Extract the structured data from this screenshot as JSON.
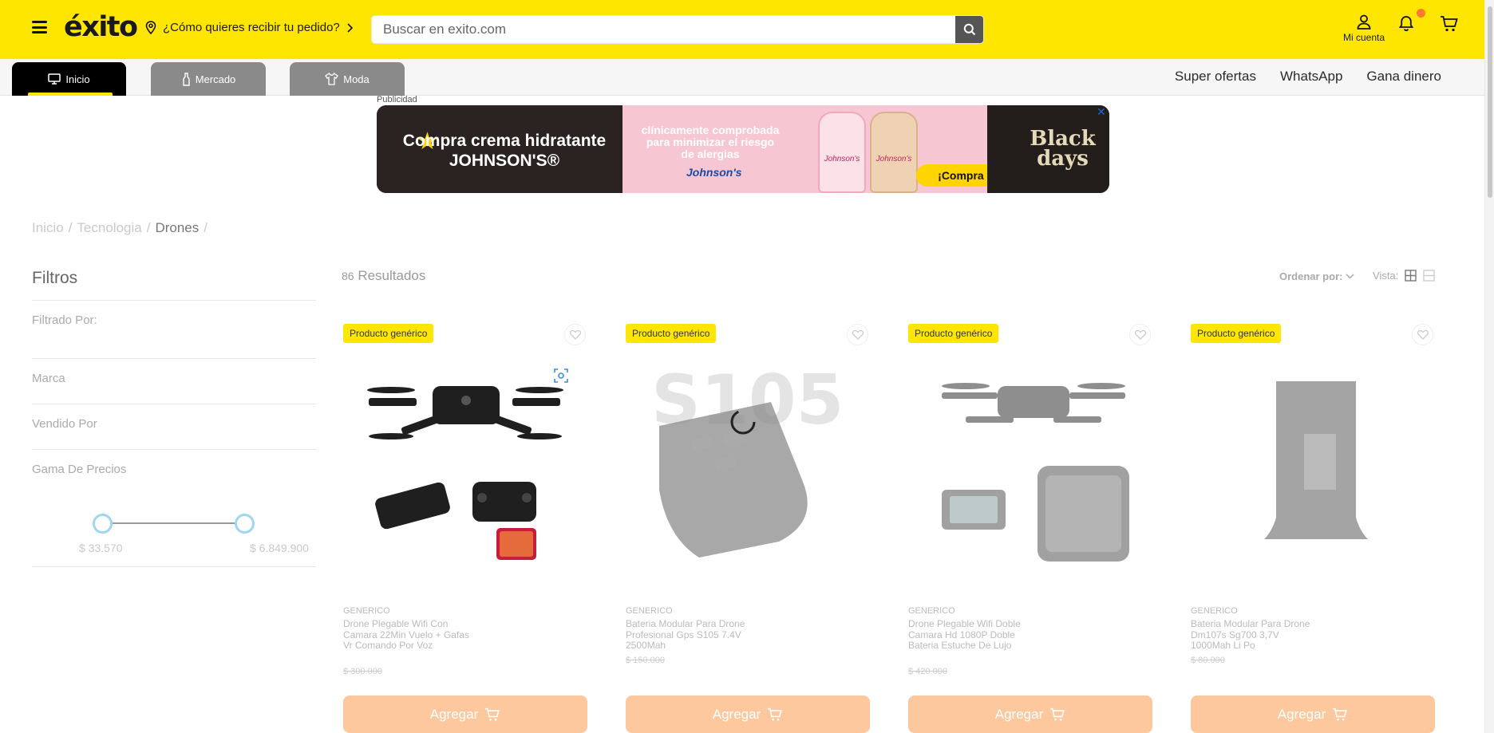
{
  "header": {
    "logo": "éxito",
    "location_prompt": "¿Cómo quieres recibir tu pedido?",
    "search_placeholder": "Buscar en exito.com",
    "account_label": "Mi cuenta"
  },
  "nav": {
    "tabs": [
      {
        "label": "Inicio",
        "icon": "monitor-icon",
        "active": true
      },
      {
        "label": "Mercado",
        "icon": "bottle-icon",
        "active": false
      },
      {
        "label": "Moda",
        "icon": "shirt-icon",
        "active": false
      }
    ],
    "links": [
      "Super ofertas",
      "WhatsApp",
      "Gana dinero"
    ]
  },
  "ad": {
    "label": "Publicidad",
    "headline": "Compra crema hidratante JOHNSON'S®",
    "claim": "clínicamente comprobada para minimizar el riesgo de alergias",
    "brand": "Johnson's",
    "bottle_labels": [
      "Johnson's",
      "Johnson's"
    ],
    "cta": "¡Compra ya!",
    "right_text": "Black days",
    "close": "✕"
  },
  "breadcrumb": [
    "Inicio",
    "Tecnologia",
    "Drones"
  ],
  "filters": {
    "title": "Filtros",
    "filtered_by": "Filtrado Por:",
    "sections": [
      "Marca",
      "Vendido Por",
      "Gama De Precios"
    ],
    "price_min": "$ 33.570",
    "price_max": "$ 6.849.900"
  },
  "results": {
    "count": "86",
    "label": "Resultados",
    "sort_label": "Ordenar por:",
    "view_label": "Vista:"
  },
  "products": [
    {
      "badge": "Producto genérico",
      "brand": "GENERICO",
      "name": "Drone Plegable Wifi Con Camara 22Min Vuelo + Gafas Vr Comando Por Voz",
      "old_price": "$ 300.000",
      "button": "Agregar"
    },
    {
      "badge": "Producto genérico",
      "brand": "GENERICO",
      "name": "Bateria Modular Para Drone Profesional Gps S105 7.4V 2500Mah",
      "old_price": "$ 150.000",
      "button": "Agregar",
      "image_text": "S105"
    },
    {
      "badge": "Producto genérico",
      "brand": "GENERICO",
      "name": "Drone Plegable Wifi Doble Camara Hd 1080P Doble Bateria Estuche De Lujo",
      "old_price": "$ 420.000",
      "button": "Agregar"
    },
    {
      "badge": "Producto genérico",
      "brand": "GENERICO",
      "name": "Bateria Modular Para Drone Dm107s Sg700 3,7V 1000Mah Li Po",
      "old_price": "$ 80.000",
      "button": "Agregar"
    }
  ],
  "colors": {
    "brand_yellow": "#ffe600",
    "add_button": "#fdc89d",
    "notification_dot": "#ff7a2e"
  }
}
